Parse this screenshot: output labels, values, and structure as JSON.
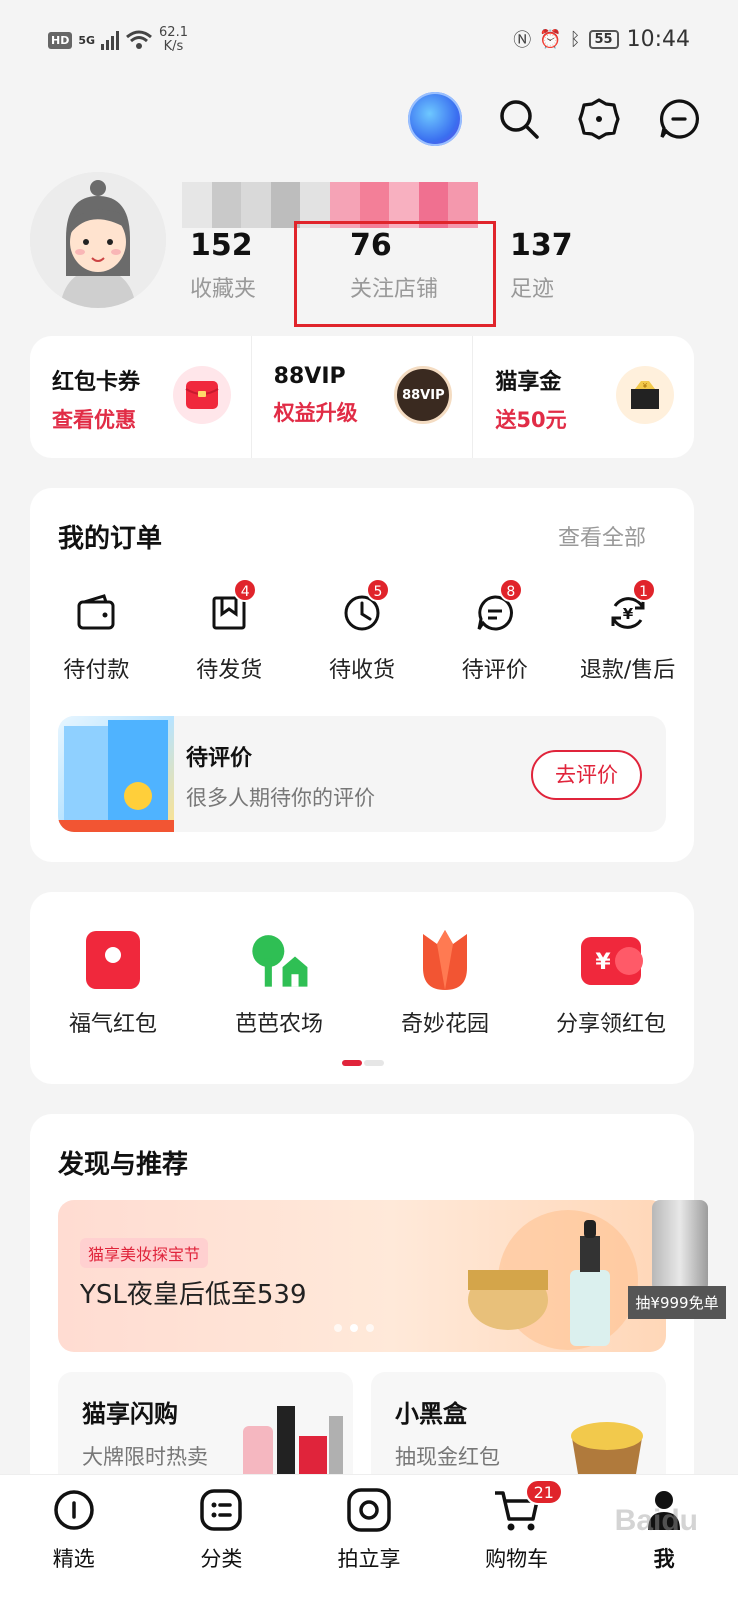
{
  "status_bar": {
    "hd": "HD",
    "network": "5G",
    "speed_value": "62.1",
    "speed_unit": "K/s",
    "battery": "55",
    "time": "10:44"
  },
  "header": {
    "icons": [
      "vip-bubble",
      "search-icon",
      "settings-icon",
      "message-icon"
    ]
  },
  "profile": {
    "stats": [
      {
        "num": "152",
        "label": "收藏夹"
      },
      {
        "num": "76",
        "label": "关注店铺"
      },
      {
        "num": "137",
        "label": "足迹"
      }
    ]
  },
  "quick": [
    {
      "title": "红包卡券",
      "sub": "查看优惠",
      "icon": "red-envelope-icon"
    },
    {
      "title": "88VIP",
      "sub": "权益升级",
      "icon": "88vip-badge",
      "badge_text": "88VIP"
    },
    {
      "title": "猫享金",
      "sub": "送50元",
      "icon": "wallet-icon"
    }
  ],
  "orders": {
    "title": "我的订单",
    "more": "查看全部",
    "items": [
      {
        "label": "待付款",
        "badge": ""
      },
      {
        "label": "待发货",
        "badge": "4"
      },
      {
        "label": "待收货",
        "badge": "5"
      },
      {
        "label": "待评价",
        "badge": "8"
      },
      {
        "label": "退款/售后",
        "badge": "1"
      }
    ],
    "pending": {
      "title": "待评价",
      "sub": "很多人期待你的评价",
      "button": "去评价"
    }
  },
  "fun": [
    {
      "label": "福气红包",
      "color": "#f0283c"
    },
    {
      "label": "芭芭农场",
      "color": "#2fbf54"
    },
    {
      "label": "奇妙花园",
      "color": "#f25533"
    },
    {
      "label": "分享领红包",
      "color": "#f0283c"
    }
  ],
  "discover": {
    "title": "发现与推荐",
    "banner": {
      "tag": "猫享美妆探宝节",
      "text": "YSL夜皇后低至539"
    },
    "cards": [
      {
        "title": "猫享闪购",
        "sub": "大牌限时热卖"
      },
      {
        "title": "小黑盒",
        "sub": "抽现金红包"
      }
    ]
  },
  "float_promo": {
    "label": "抽¥999免单"
  },
  "tabs": [
    {
      "label": "精选",
      "icon": "home-icon"
    },
    {
      "label": "分类",
      "icon": "category-icon"
    },
    {
      "label": "拍立享",
      "icon": "camera-icon"
    },
    {
      "label": "购物车",
      "icon": "cart-icon",
      "badge": "21"
    },
    {
      "label": "我",
      "icon": "user-icon"
    }
  ],
  "accent": "#e0242b"
}
